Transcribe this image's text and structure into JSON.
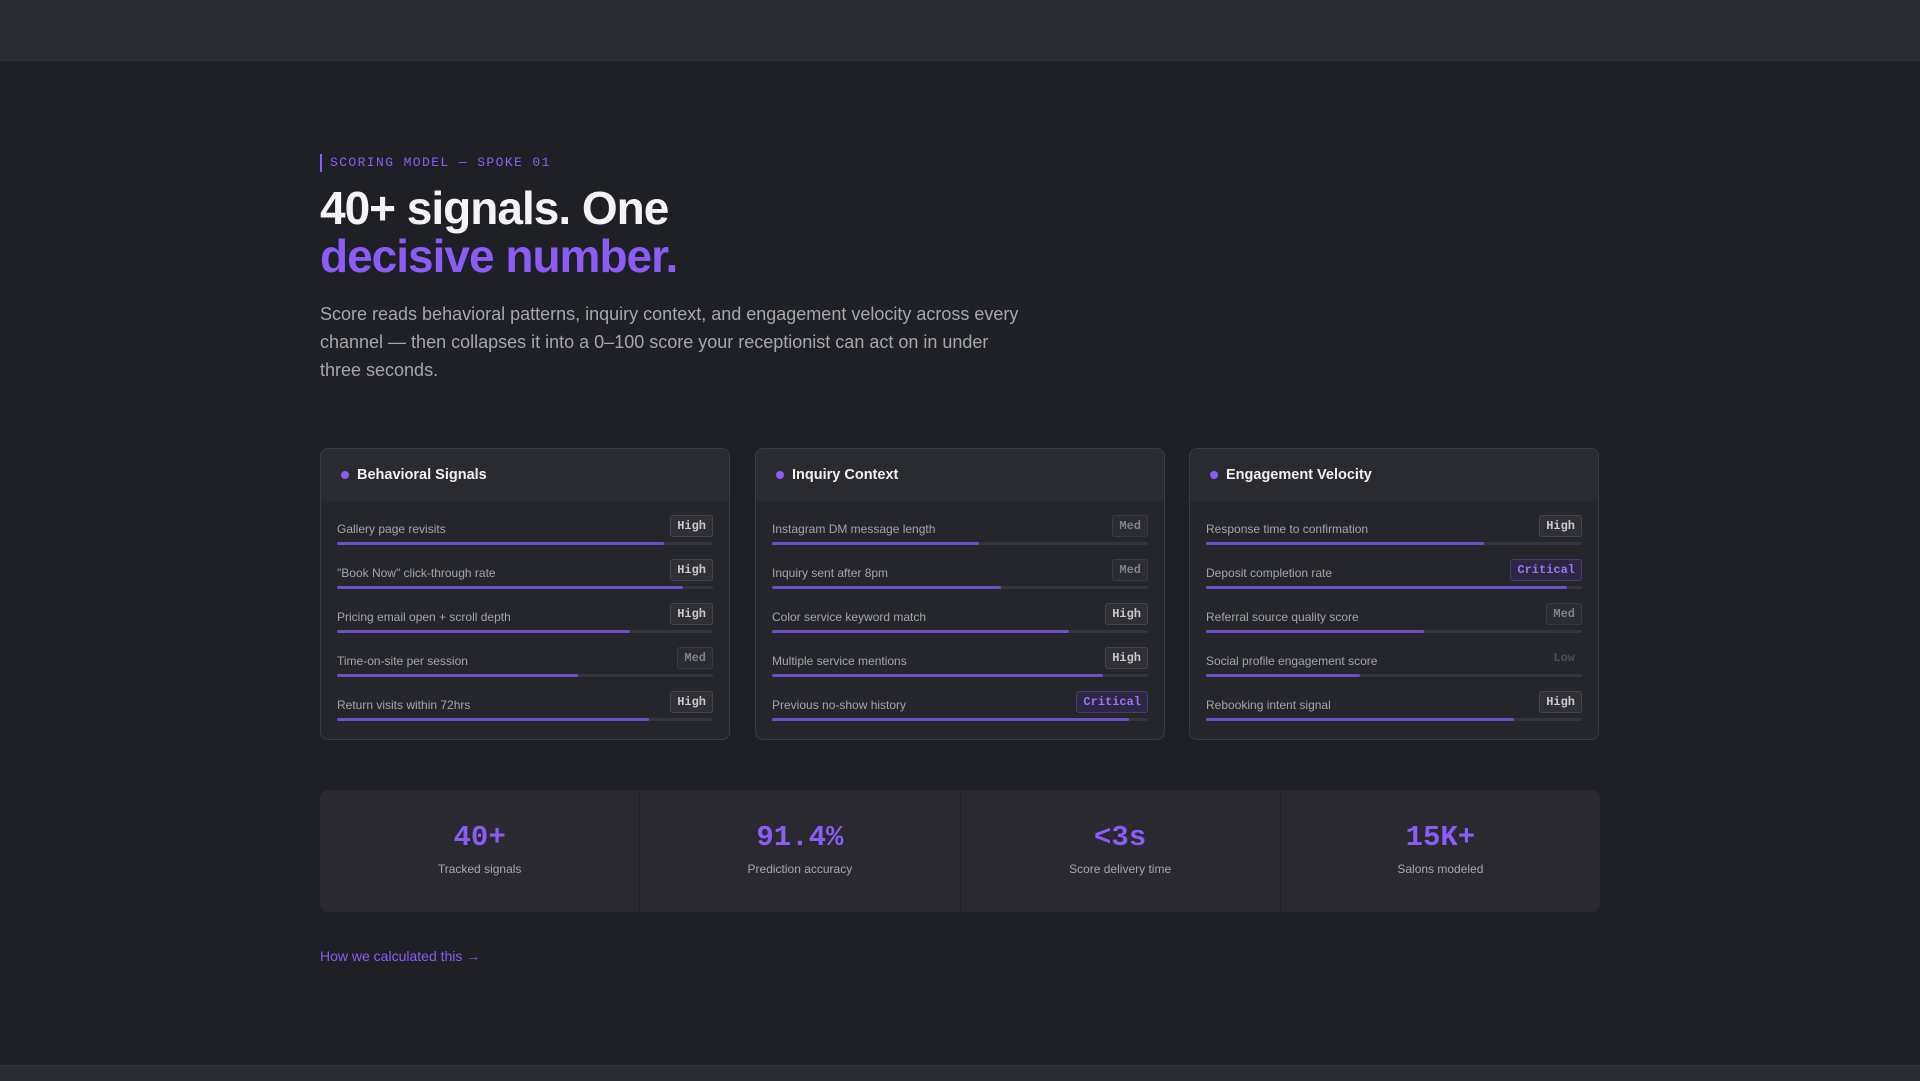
{
  "eyebrow": "SCORING MODEL — SPOKE 01",
  "headline": {
    "line1": "40+ signals. One",
    "line2": "decisive number."
  },
  "lead": "Score reads behavioral patterns, inquiry context, and engagement velocity across every channel — then collapses it into a 0–100 score your receptionist can act on in under three seconds.",
  "cards": [
    {
      "title": "Behavioral Signals",
      "rows": [
        {
          "label": "Gallery page revisits",
          "badge": "High",
          "level": "high",
          "fill": 0.87
        },
        {
          "label": "\"Book Now\" click-through rate",
          "badge": "High",
          "level": "high",
          "fill": 0.92
        },
        {
          "label": "Pricing email open + scroll depth",
          "badge": "High",
          "level": "high",
          "fill": 0.78
        },
        {
          "label": "Time-on-site per session",
          "badge": "Med",
          "level": "med",
          "fill": 0.64
        },
        {
          "label": "Return visits within 72hrs",
          "badge": "High",
          "level": "high",
          "fill": 0.83
        }
      ]
    },
    {
      "title": "Inquiry Context",
      "rows": [
        {
          "label": "Instagram DM message length",
          "badge": "Med",
          "level": "med",
          "fill": 0.55
        },
        {
          "label": "Inquiry sent after 8pm",
          "badge": "Med",
          "level": "med",
          "fill": 0.61
        },
        {
          "label": "Color service keyword match",
          "badge": "High",
          "level": "high",
          "fill": 0.79
        },
        {
          "label": "Multiple service mentions",
          "badge": "High",
          "level": "high",
          "fill": 0.88
        },
        {
          "label": "Previous no-show history",
          "badge": "Critical",
          "level": "critical",
          "fill": 0.95
        }
      ]
    },
    {
      "title": "Engagement Velocity",
      "rows": [
        {
          "label": "Response time to confirmation",
          "badge": "High",
          "level": "high",
          "fill": 0.74
        },
        {
          "label": "Deposit completion rate",
          "badge": "Critical",
          "level": "critical",
          "fill": 0.96
        },
        {
          "label": "Referral source quality score",
          "badge": "Med",
          "level": "med",
          "fill": 0.58
        },
        {
          "label": "Social profile engagement score",
          "badge": "Low",
          "level": "low",
          "fill": 0.41
        },
        {
          "label": "Rebooking intent signal",
          "badge": "High",
          "level": "high",
          "fill": 0.82
        }
      ]
    }
  ],
  "stats": [
    {
      "value": "40+",
      "label": "Tracked signals"
    },
    {
      "value": "91.4%",
      "label": "Prediction accuracy"
    },
    {
      "value": "<3s",
      "label": "Score delivery time"
    },
    {
      "value": "15K+",
      "label": "Salons modeled"
    }
  ],
  "link": "How we calculated this →",
  "colors": {
    "accent": "#8b5cf6",
    "background": "#1f2025",
    "card": "#25262b",
    "bar_fill": "#6d4fc6"
  }
}
